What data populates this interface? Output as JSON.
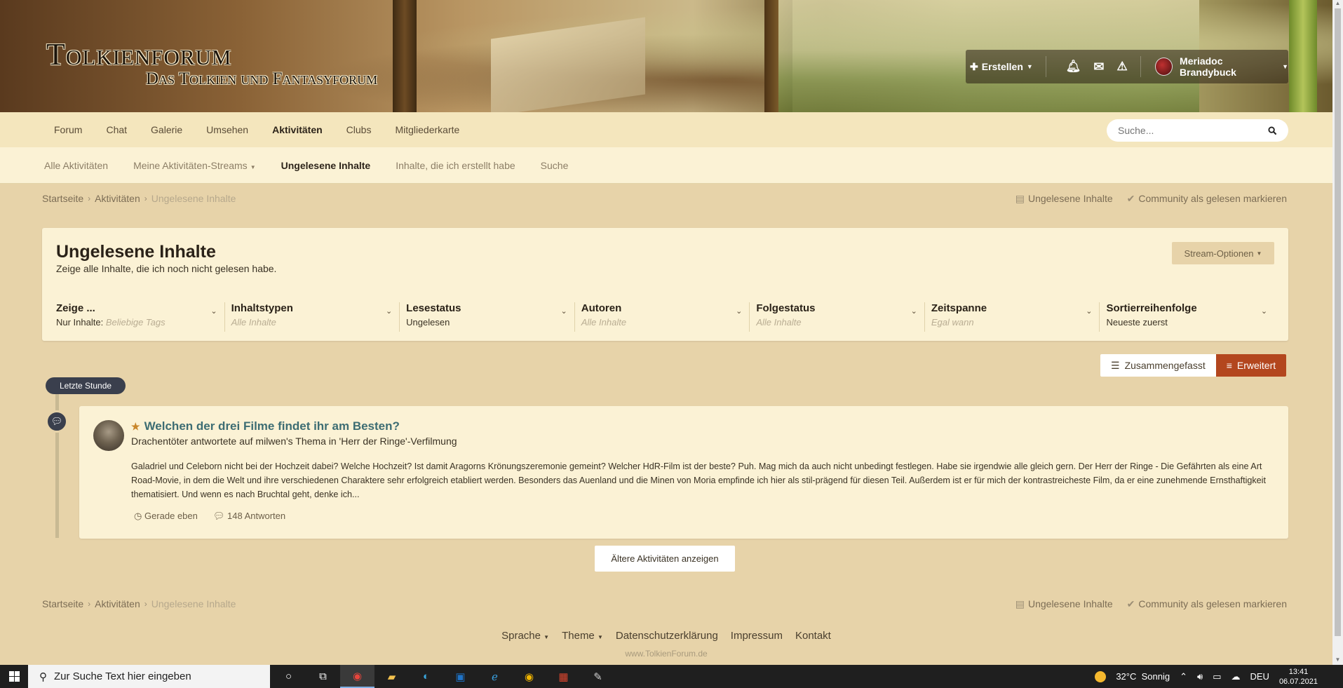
{
  "header": {
    "logo_main": "Tolkienforum",
    "logo_sub": "Das Tolkien und Fantasyforum",
    "create_label": "Erstellen",
    "user_name": "Meriadoc Brandybuck"
  },
  "nav_primary": {
    "items": [
      {
        "label": "Forum"
      },
      {
        "label": "Chat"
      },
      {
        "label": "Galerie"
      },
      {
        "label": "Umsehen"
      },
      {
        "label": "Aktivitäten"
      },
      {
        "label": "Clubs"
      },
      {
        "label": "Mitgliederkarte"
      }
    ],
    "active": "Aktivitäten",
    "search_placeholder": "Suche..."
  },
  "nav_secondary": {
    "items": [
      {
        "label": "Alle Aktivitäten"
      },
      {
        "label": "Meine Aktivitäten-Streams"
      },
      {
        "label": "Ungelesene Inhalte"
      },
      {
        "label": "Inhalte, die ich erstellt habe"
      },
      {
        "label": "Suche"
      }
    ],
    "active": "Ungelesene Inhalte"
  },
  "breadcrumb": {
    "items": [
      "Startseite",
      "Aktivitäten",
      "Ungelesene Inhalte"
    ],
    "unread_link": "Ungelesene Inhalte",
    "mark_read_link": "Community als gelesen markieren"
  },
  "panel": {
    "title": "Ungelesene Inhalte",
    "subtitle": "Zeige alle Inhalte, die ich noch nicht gelesen habe.",
    "stream_options": "Stream-Optionen",
    "filters": [
      {
        "label": "Zeige ...",
        "value": "Nur Inhalte:",
        "placeholder": "Beliebige Tags"
      },
      {
        "label": "Inhaltstypen",
        "value": "",
        "placeholder": "Alle Inhalte"
      },
      {
        "label": "Lesestatus",
        "value": "Ungelesen",
        "placeholder": ""
      },
      {
        "label": "Autoren",
        "value": "",
        "placeholder": "Alle Inhalte"
      },
      {
        "label": "Folgestatus",
        "value": "",
        "placeholder": "Alle Inhalte"
      },
      {
        "label": "Zeitspanne",
        "value": "",
        "placeholder": "Egal wann"
      },
      {
        "label": "Sortierreihenfolge",
        "value": "Neueste zuerst",
        "placeholder": ""
      }
    ]
  },
  "view_toggle": {
    "condensed": "Zusammengefasst",
    "expanded": "Erweitert",
    "active": "Erweitert"
  },
  "timeline": {
    "badge": "Letzte Stunde"
  },
  "post": {
    "title": "Welchen der drei Filme findet ihr am Besten?",
    "meta": "Drachentöter antwortete auf milwen's Thema in 'Herr der Ringe'-Verfilmung",
    "excerpt": "Galadriel und Celeborn nicht bei der Hochzeit dabei? Welche Hochzeit? Ist damit Aragorns Krönungszeremonie gemeint? Welcher HdR-Film ist der beste? Puh. Mag mich da auch nicht unbedingt festlegen. Habe sie irgendwie alle gleich gern. Der Herr der Ringe - Die Gefährten als eine Art Road-Movie, in dem die Welt und ihre verschiedenen Charaktere sehr erfolgreich etabliert werden. Besonders das Auenland und die Minen von Moria empfinde ich hier als stil-prägend für diesen Teil. Außerdem ist er für mich der kontrastreicheste Film, da er eine zunehmende Ernsthaftigkeit thematisiert. Und wenn es nach Bruchtal geht, denke ich...",
    "time": "Gerade eben",
    "replies": "148 Antworten"
  },
  "older_button": "Ältere Aktivitäten anzeigen",
  "footer": {
    "links": [
      "Sprache",
      "Theme",
      "Datenschutzerklärung",
      "Impressum",
      "Kontakt"
    ],
    "site": "www.TolkienForum.de"
  },
  "taskbar": {
    "search_placeholder": "Zur Suche Text hier eingeben",
    "weather": "32°C  Sonnig",
    "lang": "DEU",
    "time": "13:41",
    "date": "06.07.2021"
  },
  "colors": {
    "accent": "#b3461e",
    "link": "#3d6d73",
    "panel": "#fbf2d5",
    "background": "#e7d3a9"
  }
}
